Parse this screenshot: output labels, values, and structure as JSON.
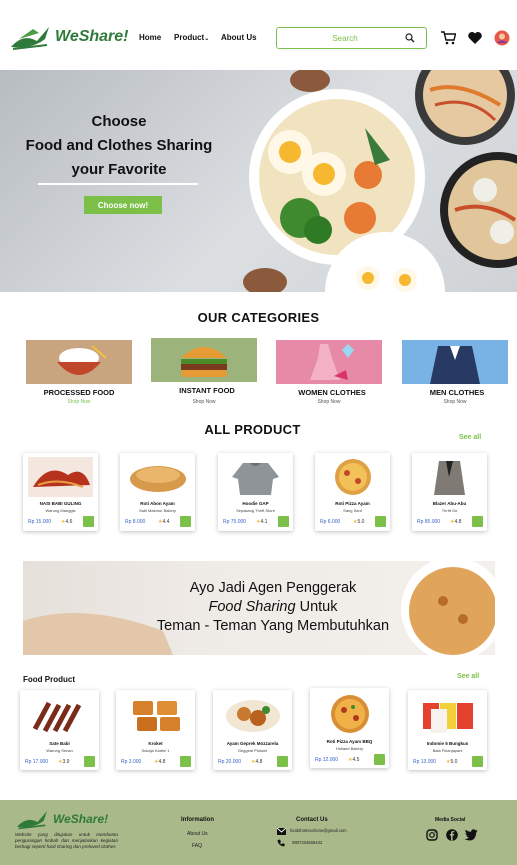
{
  "brand": {
    "name": "WeShare!"
  },
  "nav": {
    "home": "Home",
    "product": "Product",
    "about": "About Us"
  },
  "search": {
    "placeholder": "Search"
  },
  "icons": {
    "cart": "cart-icon",
    "wishlist": "heart-icon",
    "profile": "avatar-icon",
    "search": "search-icon"
  },
  "colors": {
    "accent": "#7cc04a",
    "brand": "#2f7a3a",
    "price": "#3a64c8",
    "footer": "#a9b98a"
  },
  "hero": {
    "line1": "Choose",
    "line2": "Food and Clothes Sharing",
    "line3": "your Favorite",
    "cta": "Choose now!"
  },
  "categories": {
    "title": "OUR CATEGORIES",
    "items": [
      {
        "label": "PROCESSED FOOD",
        "sub": "Shop Now"
      },
      {
        "label": "INSTANT FOOD",
        "sub": "Shop Now"
      },
      {
        "label": "WOMEN CLOTHES",
        "sub": "Shop Now"
      },
      {
        "label": "MEN CLOTHES",
        "sub": "Shop Now"
      }
    ]
  },
  "all_product": {
    "title": "ALL PRODUCT",
    "see_all": "See all",
    "items": [
      {
        "name": "NASI BABI GULING",
        "sub": "Warung Manggis",
        "price": "Rp 15.000",
        "rating": "4.6"
      },
      {
        "name": "Roti Abon Ayam",
        "sub": "Sabi Makmur Bakery",
        "price": "Rp 8.000",
        "rating": "4.4"
      },
      {
        "name": "Hoodie GAP",
        "sub": "Sepasang Thrift Store",
        "price": "Rp 75.000",
        "rating": "4.1"
      },
      {
        "name": "Roti Pizza Ayam",
        "sub": "Sang Sant",
        "price": "Rp 6.000",
        "rating": "5.0"
      },
      {
        "name": "Blazer Abu-Abu",
        "sub": "Thrift Go",
        "price": "Rp 85.000",
        "rating": "4.8"
      }
    ]
  },
  "banner": {
    "line1": "Ayo Jadi Agen Penggerak",
    "line2a": "Food Sharing",
    "line2b": " Untuk",
    "line3": "Teman - Teman Yang Membutuhkan"
  },
  "food_product": {
    "title": "Food Product",
    "see_all": "See all",
    "items": [
      {
        "name": "Sate Babi",
        "sub": "Warung Senan",
        "price": "Rp 17.000",
        "rating": "3.9"
      },
      {
        "name": "Kroket",
        "sub": "Sukaja Kartini 1",
        "price": "Rp 3.000",
        "rating": "4.8"
      },
      {
        "name": "Ayam Geprek Mozzarela",
        "sub": "Geggeal Pidiumi",
        "price": "Rp 20.000",
        "rating": "4.8"
      },
      {
        "name": "Roti Pizza Ayam BBQ",
        "sub": "Holland Bakery",
        "price": "Rp 12.000",
        "rating": "4.5"
      },
      {
        "name": "Indomie 5 Bungkus",
        "sub": "Bala Finanjapani",
        "price": "Rp 13.000",
        "rating": "5.0"
      }
    ]
  },
  "footer": {
    "brand": "WeShare!",
    "description": "Website yang ditujukan untuk membantu pengurangan limbah dan menjalankan kegiatan berbagi seperti food sharing dan preloved clothes",
    "information_title": "Information",
    "about": "About Us",
    "faq": "FAQ",
    "contact_title": "Contact Us",
    "email": "foodshortexchone@gmail.com",
    "phone": "0807234565432",
    "social_title": "Media Social"
  }
}
